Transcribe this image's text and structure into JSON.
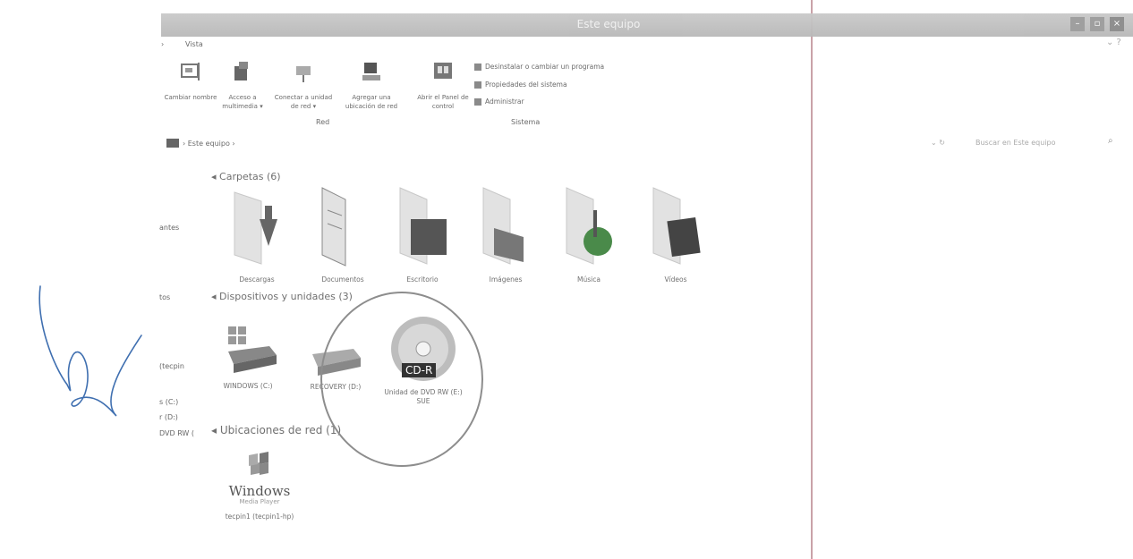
{
  "window": {
    "title": "Este equipo",
    "buttons": [
      "–",
      "▫",
      "×"
    ]
  },
  "ribbon": {
    "tab": "Vista",
    "items": [
      {
        "label": "Cambiar nombre"
      },
      {
        "label": "Acceso a multimedia ▾"
      },
      {
        "label": "Conectar a unidad de red ▾"
      },
      {
        "label": "Agregar una ubicación de red"
      },
      {
        "label": "Abrir el Panel de control"
      }
    ],
    "group_red": "Red",
    "group_sistema": "Sistema",
    "system_links": [
      "Desinstalar o cambiar un programa",
      "Propiedades del sistema",
      "Administrar"
    ]
  },
  "address": {
    "path": "Este equipo",
    "search_placeholder": "Buscar en Este equipo"
  },
  "nav": {
    "items": [
      "antes",
      "tos",
      "(tecpin",
      "s (C:)",
      "r (D:)",
      "DVD RW ("
    ]
  },
  "sections": {
    "folders": "Carpetas (6)",
    "devices": "Dispositivos y unidades (3)",
    "network": "Ubicaciones de red (1)"
  },
  "folders": [
    "Descargas",
    "Documentos",
    "Escritorio",
    "Imágenes",
    "Música",
    "Vídeos"
  ],
  "devices": [
    {
      "label": "WINDOWS (C:)"
    },
    {
      "label": "RECOVERY (D:)"
    },
    {
      "label": "Unidad de DVD RW (E:) SUE",
      "badge": "CD-R"
    }
  ],
  "network": [
    {
      "label": "tecpin1 (tecpin1-hp)",
      "logo": "Windows",
      "logo_sub": "Media Player"
    }
  ]
}
